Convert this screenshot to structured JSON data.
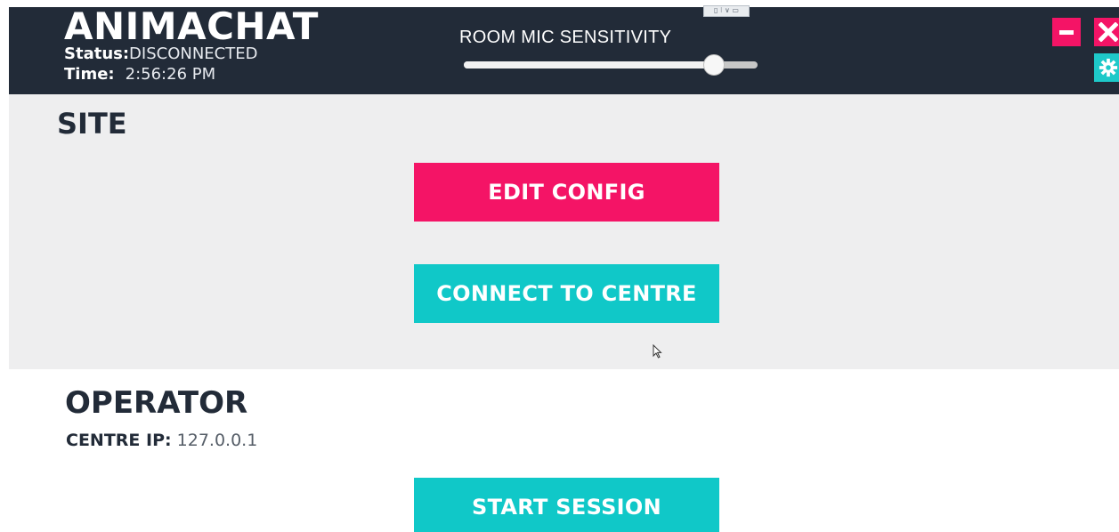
{
  "header": {
    "app_title": "ANIMACHAT",
    "status_label": "Status:",
    "status_value": "DISCONNECTED",
    "time_label": "Time:",
    "time_value": "2:56:26 PM",
    "mic_label": "ROOM MIC SENSITIVITY",
    "mic_sensitivity_fraction": 0.85,
    "tiny_widget_text": "▯ ⁝ ∨ ▭",
    "window_buttons": {
      "minimize_icon": "minus-icon",
      "close_icon": "close-icon",
      "settings_icon": "gear-icon"
    }
  },
  "site": {
    "title": "SITE",
    "edit_config_label": "EDIT CONFIG",
    "connect_label": "CONNECT TO CENTRE"
  },
  "operator": {
    "title": "OPERATOR",
    "centre_ip_label": "CENTRE IP:",
    "centre_ip_value": "127.0.0.1",
    "start_session_label": "START SESSION"
  },
  "colors": {
    "header_bg": "#222b38",
    "accent_pink": "#f41466",
    "accent_teal": "#10c8c8",
    "section_bg": "#eeeeef"
  }
}
